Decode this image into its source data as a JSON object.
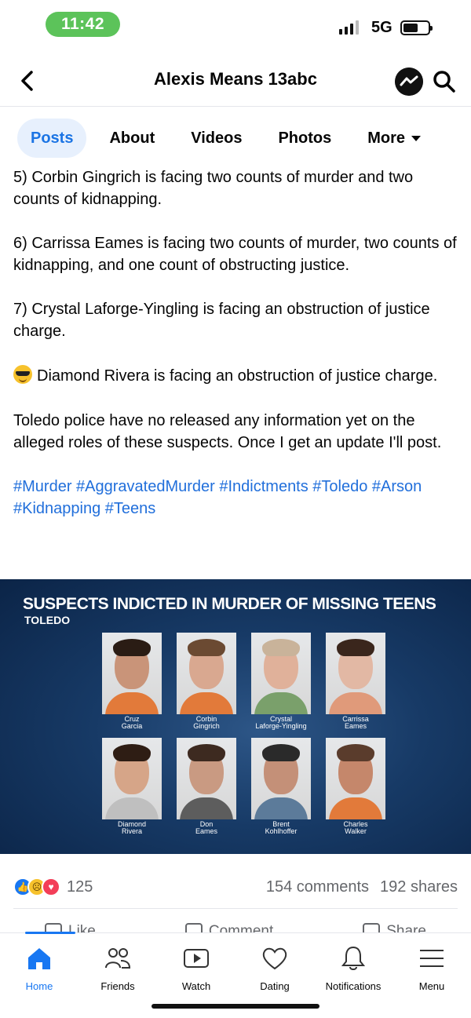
{
  "status_bar": {
    "time": "11:42",
    "network": "5G"
  },
  "header": {
    "title": "Alexis Means 13abc"
  },
  "tabs": [
    {
      "label": "Posts",
      "active": true
    },
    {
      "label": "About",
      "active": false
    },
    {
      "label": "Videos",
      "active": false
    },
    {
      "label": "Photos",
      "active": false
    },
    {
      "label": "More",
      "active": false
    }
  ],
  "post": {
    "paragraphs": [
      "5) Corbin Gingrich is facing two counts of murder and two counts of kidnapping.",
      "6) Carrissa Eames is facing two counts of murder, two counts of kidnapping, and one count of obstructing justice.",
      "7) Crystal Laforge-Yingling is facing an obstruction of justice charge.",
      "Diamond Rivera is facing an obstruction of justice charge.",
      "Toledo police have no released any information yet on the alleged roles of these suspects. Once I get an update I'll post."
    ],
    "hashtags": "#Murder #AggravatedMurder #Indictments #Toledo #Arson #Kidnapping #Teens",
    "image": {
      "headline": "SUSPECTS INDICTED IN MURDER OF MISSING TEENS",
      "subheadline": "TOLEDO",
      "people": [
        "Cruz\nGarcia",
        "Corbin\nGingrich",
        "Crystal\nLaforge-Yingling",
        "Carrissa\nEames",
        "Diamond\nRivera",
        "Don\nEames",
        "Brent\nKohlhoffer",
        "Charles\nWalker"
      ]
    },
    "reactions": {
      "count": "125",
      "comments": "154 comments",
      "shares": "192 shares"
    },
    "actions": {
      "like": "Like",
      "comment": "Comment",
      "share": "Share"
    }
  },
  "bottom_nav": [
    {
      "label": "Home",
      "icon": "home-icon",
      "active": true
    },
    {
      "label": "Friends",
      "icon": "friends-icon",
      "active": false
    },
    {
      "label": "Watch",
      "icon": "watch-icon",
      "active": false
    },
    {
      "label": "Dating",
      "icon": "dating-icon",
      "active": false
    },
    {
      "label": "Notifications",
      "icon": "bell-icon",
      "active": false
    },
    {
      "label": "Menu",
      "icon": "menu-icon",
      "active": false
    }
  ],
  "colors": {
    "accent": "#1877f2",
    "hashtag": "#216fdb",
    "time_pill": "#5cc35a"
  }
}
